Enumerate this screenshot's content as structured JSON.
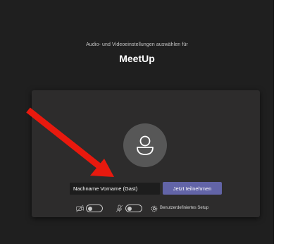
{
  "header": {
    "subtitle": "Audio- und Videoeinstellungen auswählen für",
    "title": "MeetUp"
  },
  "prejoin": {
    "name_value": "Nachname Vorname (Gast)",
    "join_label": "Jetzt teilnehmen",
    "camera_toggle_on": false,
    "mic_toggle_on": false,
    "setup_label": "Benutzerdefiniertes Setup"
  },
  "icons": {
    "avatar": "person-icon",
    "camera": "camera-off-icon",
    "mic": "mic-off-icon",
    "setup": "gear-icon",
    "annotation": "red-arrow"
  },
  "colors": {
    "background": "#1f1f1f",
    "panel": "#2d2c2c",
    "join_button": "#6264a7",
    "arrow": "#e8190e"
  }
}
